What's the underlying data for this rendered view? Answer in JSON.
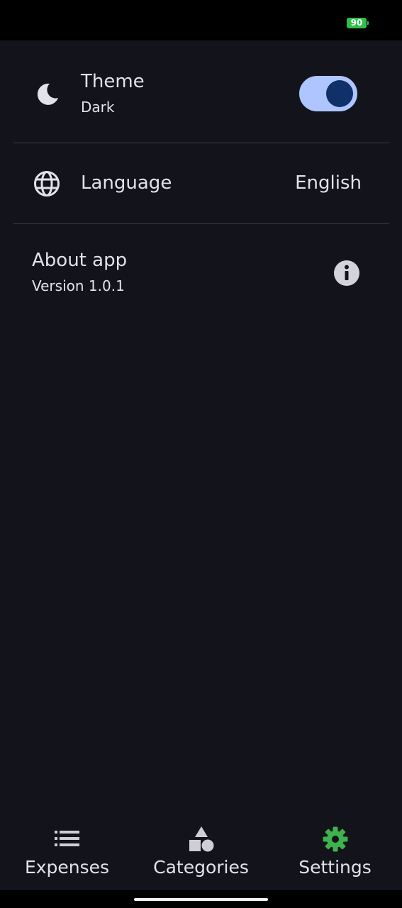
{
  "status_bar": {
    "battery_level": "90",
    "battery_color": "#2fbf4a"
  },
  "settings": {
    "theme": {
      "title": "Theme",
      "value": "Dark",
      "icon": "moon-icon",
      "switch_on": true
    },
    "language": {
      "title": "Language",
      "value": "English",
      "icon": "globe-icon"
    },
    "about": {
      "title": "About app",
      "version": "Version 1.0.1",
      "icon": "info-icon"
    }
  },
  "bottom_nav": {
    "items": [
      {
        "label": "Expenses",
        "icon": "list-icon",
        "active": false
      },
      {
        "label": "Categories",
        "icon": "shapes-icon",
        "active": false
      },
      {
        "label": "Settings",
        "icon": "gear-icon",
        "active": true
      }
    ],
    "active_color": "#3fb24e"
  },
  "colors": {
    "background": "#13141b",
    "switch_track": "#aec5ff",
    "switch_thumb": "#0f3068",
    "text": "#e3e2ea"
  }
}
